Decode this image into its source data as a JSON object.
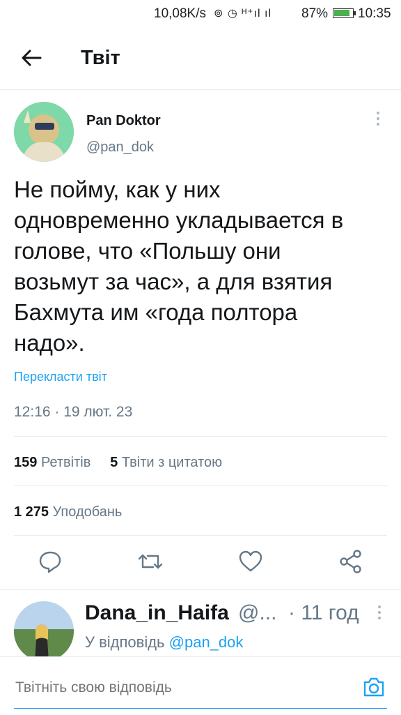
{
  "status_bar": {
    "network_speed": "10,08K/s",
    "signal_icons": "⊚ ◷ ᴴ⁺ıl ıl",
    "battery_percent": "87%",
    "battery_level": 0.87,
    "time": "10:35"
  },
  "header": {
    "title": "Твіт"
  },
  "tweet": {
    "author_name": "Pan Doktor",
    "author_handle": "@pan_dok",
    "text": "Не пойму, как у них\nодновременно укладывается в\nголове, что «Польшу они\nвозьмут за час», а для взятия\nБахмута им «года полтора\nнадо».",
    "translate_label": "Перекласти твіт",
    "datetime": "12:16 · 19 лют. 23",
    "retweets_count": "159",
    "retweets_label": "Ретвітів",
    "quotes_count": "5",
    "quotes_label": "Твіти з цитатою",
    "likes_count": "1 275",
    "likes_label": "Уподобань"
  },
  "reply": {
    "author_name": "Dana_in_Haifa",
    "handle_truncated": "@...",
    "time": "· 11 год",
    "reply_prefix": "У відповідь",
    "mention": "@pan_dok"
  },
  "compose": {
    "placeholder": "Твітніть свою відповідь"
  },
  "colors": {
    "accent": "#1da1f2",
    "muted": "#657786",
    "text": "#14171a"
  },
  "icons": [
    "back-arrow-icon",
    "more-vertical-icon",
    "reply-icon",
    "retweet-icon",
    "like-icon",
    "share-icon",
    "camera-icon"
  ]
}
